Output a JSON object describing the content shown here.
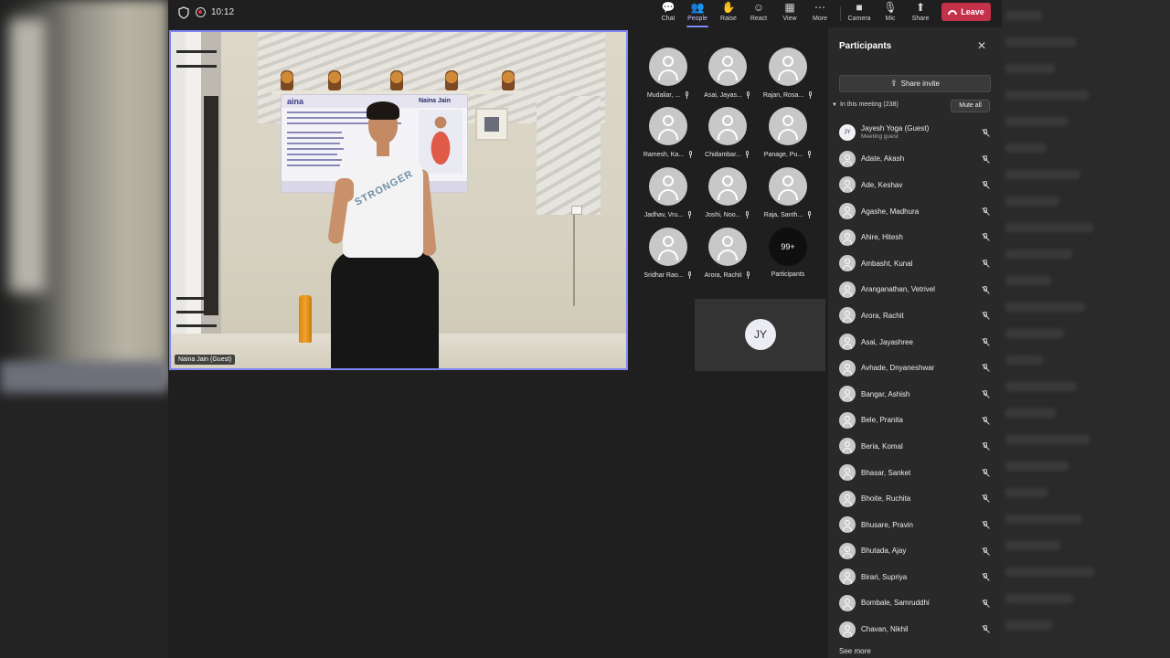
{
  "topbar": {
    "time": "10:12",
    "buttons": [
      {
        "label": "Chat",
        "icon": "chat-icon",
        "glyph": "💬"
      },
      {
        "label": "People",
        "icon": "people-icon",
        "glyph": "👥"
      },
      {
        "label": "Raise",
        "icon": "raise-hand-icon",
        "glyph": "✋"
      },
      {
        "label": "React",
        "icon": "react-icon",
        "glyph": "☺"
      },
      {
        "label": "View",
        "icon": "view-icon",
        "glyph": "▦"
      },
      {
        "label": "More",
        "icon": "more-icon",
        "glyph": "⋯"
      },
      {
        "label": "Camera",
        "icon": "camera-icon",
        "glyph": "■"
      },
      {
        "label": "Mic",
        "icon": "mic-icon",
        "glyph": "🎙"
      },
      {
        "label": "Share",
        "icon": "share-icon",
        "glyph": "⬆"
      }
    ],
    "leave_label": "Leave",
    "leave_color": "#c4314b",
    "accent_color": "#7f85f5"
  },
  "video": {
    "speaker_name": "Naina Jain (Guest)",
    "banner_logo": "aina",
    "banner_name": "Naina Jain",
    "shirt_print": "STRONGER"
  },
  "tiles": [
    {
      "name": "Mudaliar, ..."
    },
    {
      "name": "Asai, Jayas..."
    },
    {
      "name": "Rajan, Rosa..."
    },
    {
      "name": "Ramesh, Ka..."
    },
    {
      "name": "Chidambar..."
    },
    {
      "name": "Panage, Pu..."
    },
    {
      "name": "Jadhav, Vru..."
    },
    {
      "name": "Joshi, Noo..."
    },
    {
      "name": "Raja, Santh..."
    },
    {
      "name": "Sridhar Rao..."
    },
    {
      "name": "Arora, Rachit"
    }
  ],
  "overflow_tile": {
    "count": "99+",
    "label": "Participants"
  },
  "self_view": {
    "initials": "JY"
  },
  "panel": {
    "title": "Participants",
    "share_invite": "Share invite",
    "in_meeting": "In this meeting (238)",
    "mute_all": "Mute all",
    "host": {
      "initials": "JY",
      "name": "Jayesh Yoga (Guest)",
      "role": "Meeting guest"
    },
    "participants": [
      "Adate, Akash",
      "Ade, Keshav",
      "Agashe, Madhura",
      "Ahire, Hitesh",
      "Ambasht, Kunal",
      "Aranganathan, Vetrivel",
      "Arora, Rachit",
      "Asai, Jayashree",
      "Avhade, Dnyaneshwar",
      "Bangar, Ashish",
      "Bele, Pranita",
      "Beria, Komal",
      "Bhasar, Sanket",
      "Bhoite, Ruchita",
      "Bhusare, Pravin",
      "Bhutada, Ajay",
      "Birari, Supriya",
      "Bombale, Samruddhi",
      "Chavan, Nikhil"
    ],
    "see_more": "See more"
  }
}
